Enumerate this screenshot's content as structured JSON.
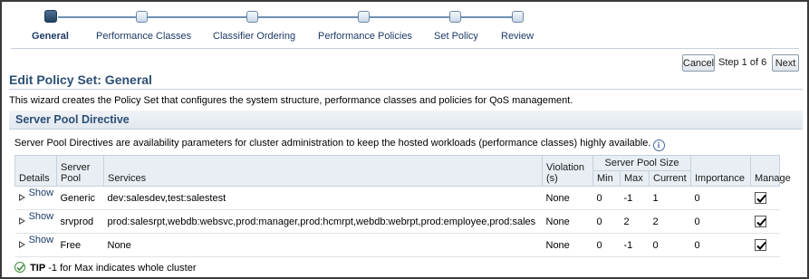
{
  "wizard": {
    "steps": [
      {
        "label": "General",
        "current": true
      },
      {
        "label": "Performance Classes",
        "current": false
      },
      {
        "label": "Classifier Ordering",
        "current": false
      },
      {
        "label": "Performance Policies",
        "current": false
      },
      {
        "label": "Set Policy",
        "current": false
      },
      {
        "label": "Review",
        "current": false
      }
    ],
    "cancel_label": "Cancel",
    "step_text": "Step 1 of 6",
    "next_label": "Next"
  },
  "page": {
    "title": "Edit Policy Set: General",
    "intro": "This wizard creates the Policy Set that configures the system structure, performance classes and policies for QoS management."
  },
  "section": {
    "title": "Server Pool Directive",
    "description": "Server Pool Directives are availability parameters for cluster administration to keep the hosted workloads (performance classes) highly available."
  },
  "table": {
    "headers": {
      "details": "Details",
      "server_pool": "Server Pool",
      "services": "Services",
      "violation": "Violation (s)",
      "server_pool_size": "Server Pool Size",
      "min": "Min",
      "max": "Max",
      "current": "Current",
      "importance": "Importance",
      "manage": "Manage"
    },
    "rows": [
      {
        "show": "Show",
        "pool": "Generic",
        "services": "dev:salesdev,test:salestest",
        "violation": "None",
        "min": "0",
        "max": "-1",
        "current": "1",
        "importance": "0",
        "manage": true
      },
      {
        "show": "Show",
        "pool": "srvprod",
        "services": "prod:salesrpt,webdb:websvc,prod:manager,prod:hcmrpt,webdb:webrpt,prod:employee,prod:sales",
        "violation": "None",
        "min": "0",
        "max": "2",
        "current": "2",
        "importance": "0",
        "manage": true
      },
      {
        "show": "Show",
        "pool": "Free",
        "services": "None",
        "violation": "None",
        "min": "0",
        "max": "-1",
        "current": "0",
        "importance": "0",
        "manage": true
      }
    ]
  },
  "tip": {
    "label": "TIP",
    "text": "-1 for Max indicates whole cluster"
  },
  "colors": {
    "title": "#2c4f75",
    "link": "#1c3a66",
    "header_bg": "#e9eef4"
  }
}
